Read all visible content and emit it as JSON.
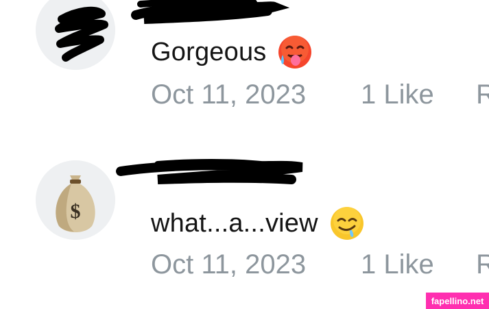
{
  "comments": [
    {
      "text": "Gorgeous",
      "emoji": "hot-face-emoji",
      "date": "Oct 11, 2023",
      "likes": "1 Like",
      "reply": "R"
    },
    {
      "text": "what...a...view",
      "emoji": "drooling-face-emoji",
      "date": "Oct 11, 2023",
      "likes": "1 Like",
      "reply": "R",
      "avatar_symbol": "$"
    }
  ],
  "watermark": "fapellino.net",
  "colors": {
    "text": "#141414",
    "meta": "#8d969d",
    "watermark_bg": "#ff2fb0",
    "redaction": "#000000"
  }
}
